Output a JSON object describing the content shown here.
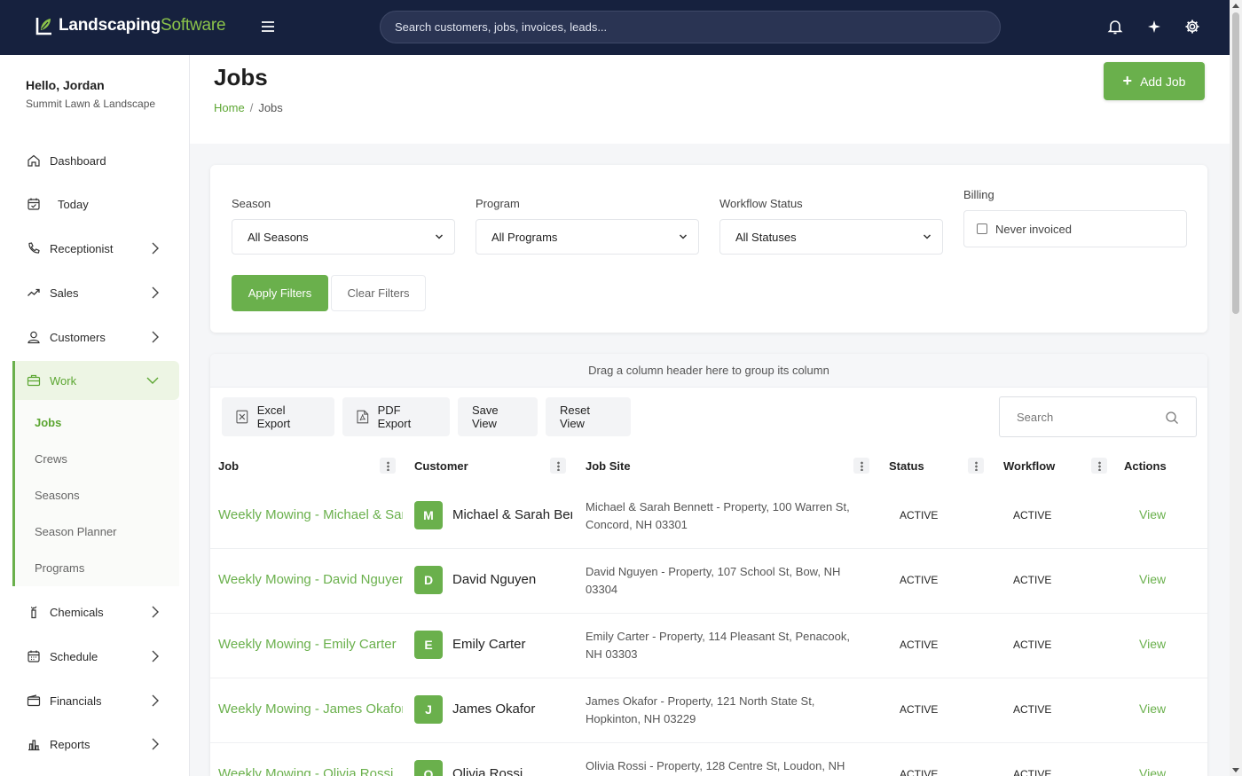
{
  "brand": {
    "name_bold": "Landscaping",
    "name_light": "Software"
  },
  "topbar": {
    "search_placeholder": "Search customers, jobs, invoices, leads..."
  },
  "user": {
    "greeting": "Hello, Jordan",
    "company": "Summit Lawn & Landscape"
  },
  "sidebar": {
    "items": [
      {
        "label": "Dashboard",
        "icon": "home-icon"
      },
      {
        "label": "Today",
        "icon": "calendar-check-icon"
      },
      {
        "label": "Receptionist",
        "icon": "phone-icon"
      },
      {
        "label": "Sales",
        "icon": "trend-icon"
      },
      {
        "label": "Customers",
        "icon": "user-icon"
      },
      {
        "label": "Work",
        "icon": "briefcase-icon"
      },
      {
        "label": "Chemicals",
        "icon": "spray-icon"
      },
      {
        "label": "Schedule",
        "icon": "calendar-icon"
      },
      {
        "label": "Financials",
        "icon": "wallet-icon"
      },
      {
        "label": "Reports",
        "icon": "bar-chart-icon"
      }
    ],
    "work_sub": [
      "Jobs",
      "Crews",
      "Seasons",
      "Season Planner",
      "Programs"
    ]
  },
  "page": {
    "title": "Jobs",
    "breadcrumb_home": "Home",
    "breadcrumb_sep": "/",
    "breadcrumb_current": "Jobs",
    "add_button": "Add Job",
    "add_plus": "+"
  },
  "filters": {
    "season_label": "Season",
    "season_value": "All Seasons",
    "program_label": "Program",
    "program_value": "All Programs",
    "workflow_label": "Workflow Status",
    "workflow_value": "All Statuses",
    "billing_label": "Billing",
    "billing_option": "Never invoiced",
    "apply": "Apply Filters",
    "clear": "Clear Filters"
  },
  "grid": {
    "group_hint": "Drag a column header here to group its column",
    "excel": "Excel Export",
    "pdf": "PDF Export",
    "save_view": "Save View",
    "reset_view": "Reset View",
    "search_placeholder": "Search",
    "columns": {
      "job": "Job",
      "customer": "Customer",
      "site": "Job Site",
      "status": "Status",
      "workflow": "Workflow",
      "actions": "Actions"
    },
    "rows": [
      {
        "job": "Weekly Mowing - Michael & Sarah Bennett",
        "initial": "M",
        "customer": "Michael & Sarah Bennett",
        "site": "Michael & Sarah Bennett - Property, 100 Warren St, Concord, NH 03301",
        "status": "ACTIVE",
        "workflow": "ACTIVE",
        "action": "View"
      },
      {
        "job": "Weekly Mowing - David Nguyen",
        "initial": "D",
        "customer": "David Nguyen",
        "site": "David Nguyen - Property, 107 School St, Bow, NH 03304",
        "status": "ACTIVE",
        "workflow": "ACTIVE",
        "action": "View"
      },
      {
        "job": "Weekly Mowing - Emily Carter",
        "initial": "E",
        "customer": "Emily Carter",
        "site": "Emily Carter - Property, 114 Pleasant St, Penacook, NH 03303",
        "status": "ACTIVE",
        "workflow": "ACTIVE",
        "action": "View"
      },
      {
        "job": "Weekly Mowing - James Okafor",
        "initial": "J",
        "customer": "James Okafor",
        "site": "James Okafor - Property, 121 North State St, Hopkinton, NH 03229",
        "status": "ACTIVE",
        "workflow": "ACTIVE",
        "action": "View"
      },
      {
        "job": "Weekly Mowing - Olivia Rossi",
        "initial": "O",
        "customer": "Olivia Rossi",
        "site": "Olivia Rossi - Property, 128 Centre St, Loudon, NH",
        "status": "ACTIVE",
        "workflow": "ACTIVE",
        "action": "View"
      }
    ]
  },
  "colors": {
    "topbar": "#16213e",
    "accent": "#6ab04c"
  }
}
